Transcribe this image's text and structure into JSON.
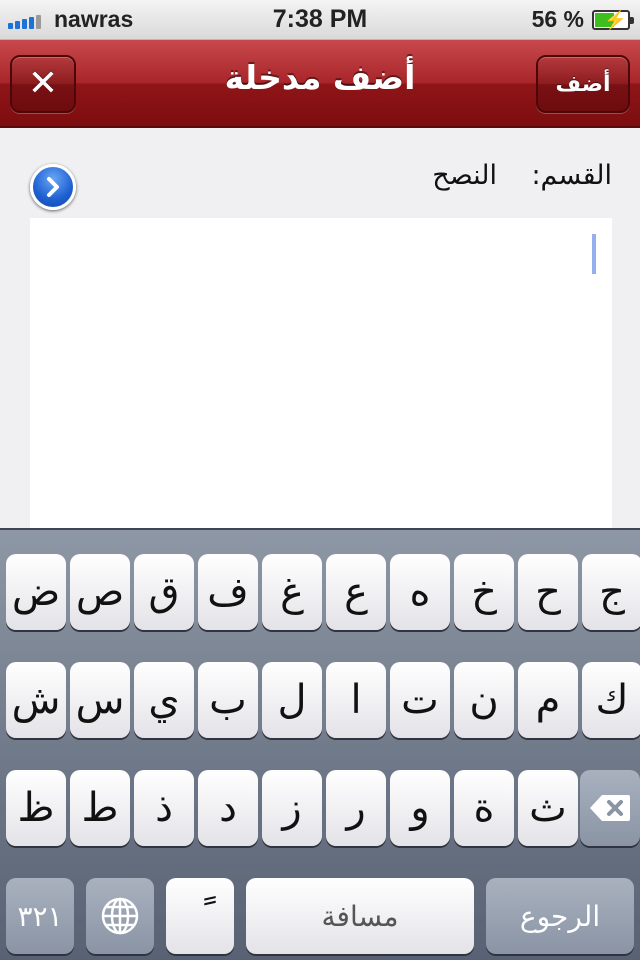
{
  "status_bar": {
    "carrier": "nawras",
    "time": "7:38 PM",
    "battery_percent": "56 %",
    "battery_level": 0.56,
    "signal_bars": 4
  },
  "nav": {
    "title": "أضف مدخلة",
    "close_icon": "close-icon",
    "add_label": "أضف"
  },
  "form": {
    "category_label": "القسم:",
    "category_value": "النصح",
    "disclosure_icon": "chevron-right-icon",
    "entry_text": ""
  },
  "keyboard": {
    "row1": [
      "ج",
      "ح",
      "خ",
      "ه",
      "ع",
      "غ",
      "ف",
      "ق",
      "ص",
      "ض"
    ],
    "row2": [
      "ك",
      "م",
      "ن",
      "ت",
      "ا",
      "ل",
      "ب",
      "ي",
      "س",
      "ش"
    ],
    "row3": [
      "ث",
      "ة",
      "و",
      "ر",
      "ز",
      "د",
      "ذ",
      "ط",
      "ظ"
    ],
    "backspace_icon": "backspace-icon",
    "numbers_label": "٣٢١",
    "globe_icon": "globe-icon",
    "diacritic_label": "ً",
    "space_label": "مسافة",
    "return_label": "الرجوع"
  }
}
